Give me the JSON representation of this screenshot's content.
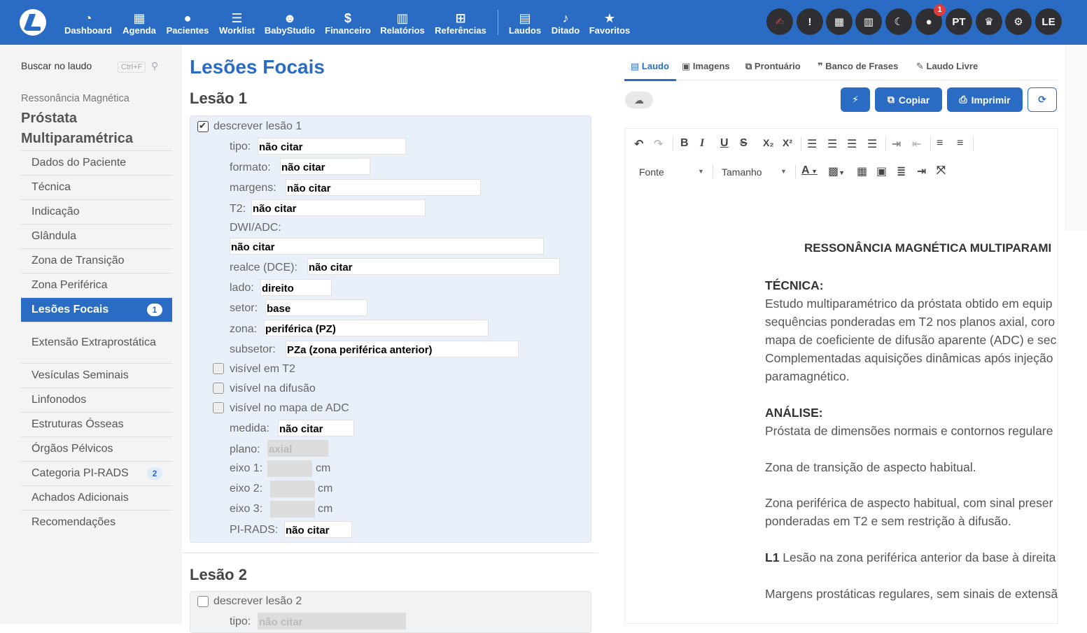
{
  "nav": {
    "items": [
      {
        "icon": "dashboard-icon",
        "label": "Dashboard"
      },
      {
        "icon": "calendar-icon",
        "label": "Agenda"
      },
      {
        "icon": "user-icon",
        "label": "Pacientes"
      },
      {
        "icon": "list-icon",
        "label": "Worklist"
      },
      {
        "icon": "baby-icon",
        "label": "BabyStudio"
      },
      {
        "icon": "dollar-icon",
        "label": "Financeiro"
      },
      {
        "icon": "chart-icon",
        "label": "Relatórios"
      },
      {
        "icon": "book-icon",
        "label": "Referências"
      },
      {
        "icon": "file-icon",
        "label": "Laudos"
      },
      {
        "icon": "microphone-icon",
        "label": "Ditado"
      },
      {
        "icon": "star-icon",
        "label": "Favoritos"
      }
    ],
    "right": {
      "notif_count": "1",
      "lang": "PT",
      "user": "LE"
    }
  },
  "sidebar": {
    "search_label": "Buscar no laudo",
    "shortcut": "Ctrl+F",
    "category": "Ressonância Magnética",
    "title_line1": "Próstata",
    "title_line2": "Multiparamétrica",
    "items": [
      {
        "label": "Dados do Paciente"
      },
      {
        "label": "Técnica"
      },
      {
        "label": "Indicação"
      },
      {
        "label": "Glândula"
      },
      {
        "label": "Zona de Transição"
      },
      {
        "label": "Zona Periférica"
      },
      {
        "label": "Lesões Focais",
        "badge": "1"
      },
      {
        "label": "Extensão Extraprostática"
      },
      {
        "label": "Vesículas Seminais"
      },
      {
        "label": "Linfonodos"
      },
      {
        "label": "Estruturas Ósseas"
      },
      {
        "label": "Órgãos Pélvicos"
      },
      {
        "label": "Categoria PI-RADS",
        "badge": "2"
      },
      {
        "label": "Achados Adicionais"
      },
      {
        "label": "Recomendações"
      }
    ]
  },
  "main": {
    "title": "Lesões Focais",
    "lesion1": {
      "title": "Lesão 1",
      "describe": "descrever lesão 1",
      "tipo_label": "tipo:",
      "tipo": "não citar",
      "formato_label": "formato:",
      "formato": "não citar",
      "margens_label": "margens:",
      "margens": "não citar",
      "t2_label": "T2:",
      "t2": "não citar",
      "dwi_label": "DWI/ADC:",
      "dwi": "não citar",
      "realce_label": "realce (DCE):",
      "realce": "não citar",
      "lado_label": "lado:",
      "lado": "direito",
      "setor_label": "setor:",
      "setor": "base",
      "zona_label": "zona:",
      "zona": "periférica (PZ)",
      "subsetor_label": "subsetor:",
      "subsetor": "PZa (zona periférica anterior)",
      "vis_t2": "visível em T2",
      "vis_dif": "visível na difusão",
      "vis_adc": "visível no mapa de ADC",
      "medida_label": "medida:",
      "medida": "não citar",
      "plano_label": "plano:",
      "plano": "axial",
      "eixo1_label": "eixo 1:",
      "eixo2_label": "eixo 2:",
      "eixo3_label": "eixo 3:",
      "unit": "cm",
      "pirads_label": "PI-RADS:",
      "pirads": "não citar"
    },
    "lesion2": {
      "title": "Lesão 2",
      "describe": "descrever lesão 2",
      "tipo_label": "tipo:",
      "tipo": "não citar"
    }
  },
  "report": {
    "tabs": [
      "Laudo",
      "Imagens",
      "Prontuário",
      "Banco de Frases",
      "Laudo Livre"
    ],
    "copy": "Copiar",
    "print": "Imprimir",
    "font_select": "Fonte",
    "size_select": "Tamanho",
    "heading": "RESSONÂNCIA MAGNÉTICA MULTIPARAMI",
    "tecnica_title": "TÉCNICA:",
    "tecnica_lines": [
      "Estudo multiparamétrico da próstata obtido em equip",
      "sequências ponderadas em T2 nos planos axial, coro",
      "mapa de coeficiente de difusão aparente (ADC) e sec",
      "Complementadas aquisições dinâmicas após injeção",
      "paramagnético."
    ],
    "analise_title": "ANÁLISE:",
    "analise_line": "Próstata de dimensões normais e contornos regulare",
    "zt_line": "Zona de transição de aspecto habitual.",
    "zp_line1": "Zona periférica de aspecto habitual, com sinal preser",
    "zp_line2": "ponderadas em T2 e sem restrição à difusão.",
    "l1_tag": "L1",
    "l1_text": " Lesão na zona periférica anterior da base à direita",
    "margens_line": "Margens prostáticas regulares, sem sinais de extensã"
  }
}
